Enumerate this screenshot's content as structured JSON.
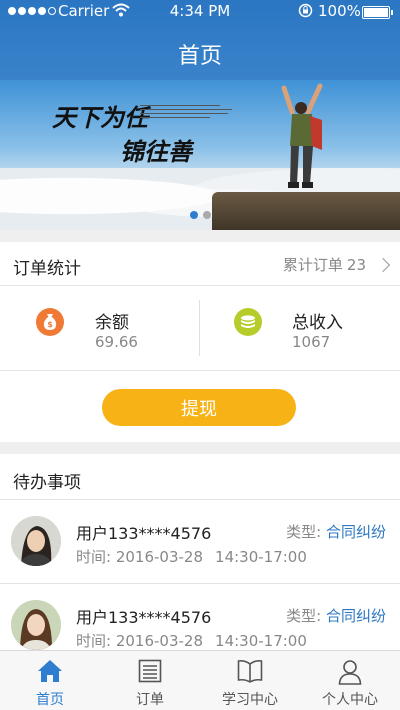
{
  "status_bar": {
    "carrier": "Carrier",
    "time": "4:34 PM",
    "battery": "100%"
  },
  "nav": {
    "title": "首页"
  },
  "banner": {
    "slogan_line1": "天下为任",
    "slogan_line2": "锦往善",
    "pages": 2,
    "active_page": 1
  },
  "order_stats": {
    "title": "订单统计",
    "total_label": "累计订单",
    "total_value": "23",
    "balance_label": "余额",
    "balance_value": "69.66",
    "income_label": "总收入",
    "income_value": "1067"
  },
  "withdraw": {
    "label": "提现"
  },
  "todo": {
    "title": "待办事项",
    "items": [
      {
        "user": "用户133****4576",
        "type_label": "类型:",
        "type_value": "合同纠纷",
        "time_label": "时间:",
        "date": "2016-03-28",
        "time_range": "14:30-17:00"
      },
      {
        "user": "用户133****4576",
        "type_label": "类型:",
        "type_value": "合同纠纷",
        "time_label": "时间:",
        "date": "2016-03-28",
        "time_range": "14:30-17:00"
      }
    ]
  },
  "tabs": [
    {
      "label": "首页",
      "icon": "home-icon",
      "active": true
    },
    {
      "label": "订单",
      "icon": "list-icon",
      "active": false
    },
    {
      "label": "学习中心",
      "icon": "book-icon",
      "active": false
    },
    {
      "label": "个人中心",
      "icon": "person-icon",
      "active": false
    }
  ],
  "colors": {
    "header": "#2b76c2",
    "accent": "#2e7dd0",
    "withdraw": "#f7b316",
    "balance_icon": "#f07a35",
    "income_icon": "#b6cc2a",
    "type_value": "#2e78c3"
  }
}
